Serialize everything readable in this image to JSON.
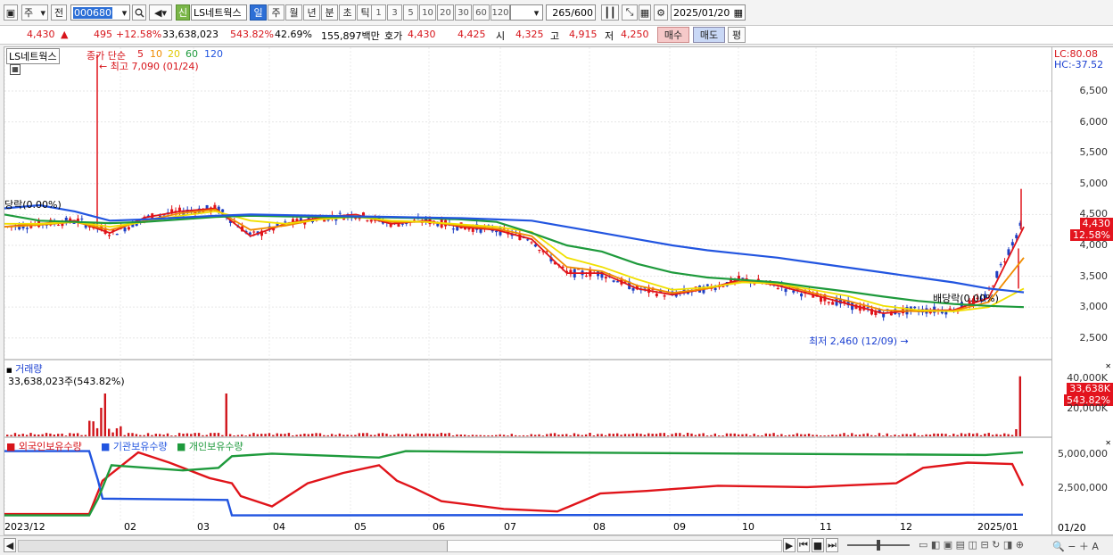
{
  "toolbar": {
    "period_select": "주",
    "prev_label": "전",
    "stock_code": "000680",
    "new_badge": "신",
    "stock_name": "LS네트웍스",
    "periods": [
      "일",
      "주",
      "월",
      "년",
      "분",
      "초",
      "틱"
    ],
    "active_period": "일",
    "intervals": [
      "1",
      "3",
      "5",
      "10",
      "20",
      "30",
      "60",
      "120"
    ],
    "count_value": "265",
    "count_total": "/600",
    "date": "2025/01/20"
  },
  "quote": {
    "price": "4,430",
    "change": "495",
    "change_pct": "+12.58%",
    "volume": "33,638,023",
    "volume_pct": "543.82%",
    "turnover_pct": "42.69%",
    "amount": "155,897백만",
    "bid_label": "호가",
    "bid": "4,430",
    "ask": "4,425",
    "open_label": "시",
    "open": "4,325",
    "high_label": "고",
    "high": "4,915",
    "low_label": "저",
    "low": "4,250",
    "buy_button": "매수",
    "sell_button": "매도",
    "eval_button": "평"
  },
  "price_panel": {
    "name_tag": "LS네트웍스",
    "legend_title": "종가 단순",
    "ma_labels": [
      "5",
      "10",
      "20",
      "60",
      "120"
    ],
    "ma_colors": [
      "#e0141a",
      "#f08c00",
      "#f0e000",
      "#1e9a3c",
      "#2255e0"
    ],
    "high_note": "최고 7,090 (01/24)",
    "low_note": "최저 2,460 (12/09)",
    "left_note": "당락(0.00%)",
    "div_note": "배당락(0.00%)",
    "lc": "LC:80.08",
    "hc": "HC:-37.52",
    "last_price_tag": "4,430",
    "last_pct_tag": "12.58%",
    "y_ticks": [
      "6,500",
      "6,000",
      "5,500",
      "5,000",
      "4,500",
      "4,000",
      "3,500",
      "3,000",
      "2,500"
    ]
  },
  "volume_panel": {
    "title": "거래량",
    "info": "33,638,023주(543.82%)",
    "y_ticks": [
      "40,000K",
      "20,000K"
    ],
    "tag_value": "33,638K",
    "tag_pct": "543.82%"
  },
  "holding_panel": {
    "legend": [
      "외국인보유수량",
      "기관보유수량",
      "개인보유수량"
    ],
    "y_ticks": [
      "5,000,000",
      "2,500,000"
    ]
  },
  "x_axis": [
    "2023/12",
    "02",
    "03",
    "04",
    "05",
    "06",
    "07",
    "08",
    "09",
    "10",
    "11",
    "12",
    "2025/01",
    "01/20"
  ],
  "chart_data": {
    "type": "line",
    "series": [
      {
        "name": "5",
        "values": [
          4300,
          4350,
          4400,
          4200,
          4450,
          4550,
          4600,
          4150,
          4350,
          4450,
          4500,
          4350,
          4400,
          4300,
          4250,
          4100,
          3550,
          3550,
          3300,
          3200,
          3300,
          3450,
          3350,
          3200,
          3050,
          2900,
          2950,
          2950,
          3150,
          4300
        ]
      },
      {
        "name": "10",
        "values": [
          4300,
          4330,
          4380,
          4250,
          4400,
          4520,
          4580,
          4250,
          4320,
          4430,
          4480,
          4380,
          4380,
          4320,
          4270,
          4150,
          3650,
          3580,
          3350,
          3230,
          3300,
          3420,
          3380,
          3230,
          3100,
          2950,
          2930,
          2940,
          3080,
          3800
        ]
      },
      {
        "name": "20",
        "values": [
          4350,
          4350,
          4380,
          4300,
          4380,
          4480,
          4550,
          4400,
          4350,
          4420,
          4460,
          4400,
          4380,
          4340,
          4300,
          4220,
          3800,
          3650,
          3450,
          3280,
          3320,
          3400,
          3380,
          3280,
          3180,
          3020,
          2950,
          2930,
          3000,
          3300
        ]
      },
      {
        "name": "60",
        "values": [
          4500,
          4400,
          4380,
          4360,
          4380,
          4420,
          4460,
          4480,
          4470,
          4460,
          4460,
          4450,
          4440,
          4420,
          4380,
          4200,
          4000,
          3900,
          3700,
          3560,
          3480,
          3440,
          3400,
          3320,
          3250,
          3170,
          3100,
          3050,
          3020,
          3000
        ]
      },
      {
        "name": "120",
        "values": [
          4600,
          4650,
          4550,
          4400,
          4420,
          4450,
          4480,
          4500,
          4490,
          4480,
          4470,
          4460,
          4450,
          4440,
          4420,
          4400,
          4300,
          4200,
          4100,
          4000,
          3920,
          3860,
          3800,
          3720,
          3640,
          3560,
          3480,
          3400,
          3300,
          3240
        ]
      }
    ],
    "price_high": 7090,
    "price_low": 2460,
    "ylim": [
      2150,
      7150
    ]
  }
}
